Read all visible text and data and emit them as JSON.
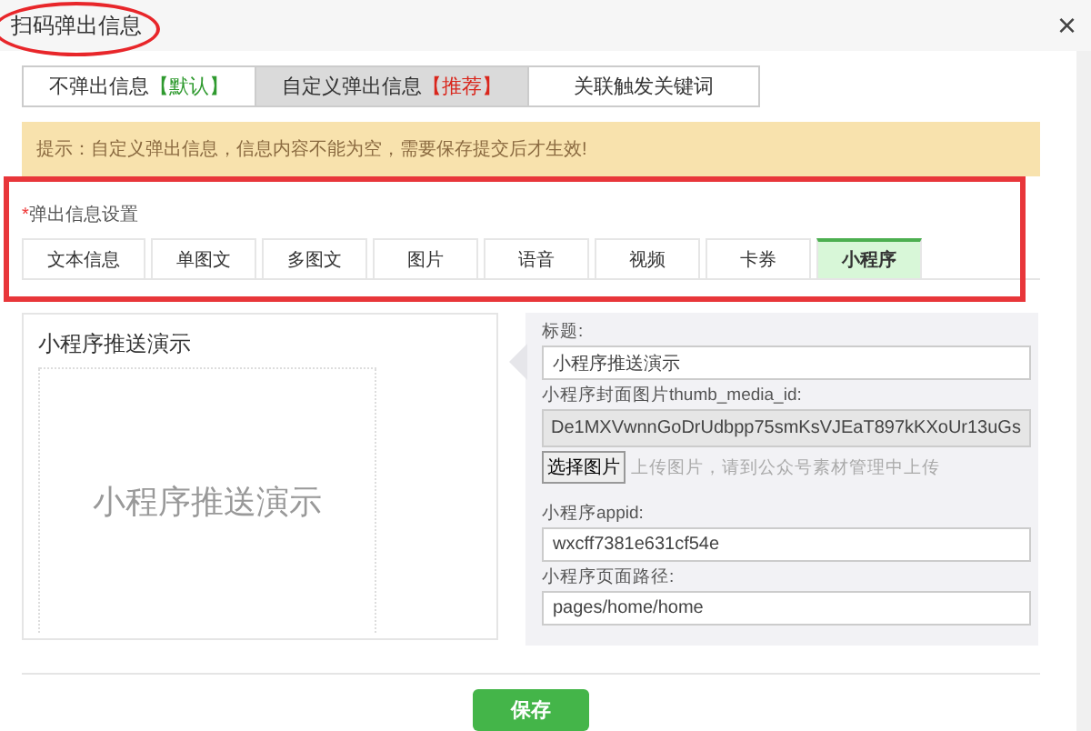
{
  "window": {
    "title": "扫码弹出信息",
    "close": "×",
    "title_circled": true
  },
  "mode_tabs": [
    {
      "label": "不弹出信息",
      "tag": "【默认】",
      "color": "#2f9a2f",
      "selected": false
    },
    {
      "label": "自定义弹出信息",
      "tag": "【推荐】",
      "color": "#d9261c",
      "selected": true
    },
    {
      "label": "关联触发关键词",
      "selected": false
    }
  ],
  "notice": "提示：自定义弹出信息，信息内容不能为空，需要保存提交后才生效!",
  "settings": {
    "framed": true,
    "required_mark": "*",
    "label": "弹出信息设置",
    "tabs": [
      {
        "label": "文本信息",
        "selected": false
      },
      {
        "label": "单图文",
        "selected": false
      },
      {
        "label": "多图文",
        "selected": false
      },
      {
        "label": "图片",
        "selected": false
      },
      {
        "label": "语音",
        "selected": false
      },
      {
        "label": "视频",
        "selected": false
      },
      {
        "label": "卡券",
        "selected": false
      },
      {
        "label": "小程序",
        "selected": true
      }
    ]
  },
  "preview": {
    "title": "小程序推送演示",
    "cover_text": "小程序推送演示"
  },
  "form": [
    {
      "kind": "input",
      "label": "标题:",
      "value": "小程序推送演示"
    },
    {
      "kind": "readonly",
      "label": "小程序封面图片thumb_media_id:",
      "value": "De1MXVwnnGoDrUdbpp75smKsVJEaT897kKXoUr13uGs"
    },
    {
      "kind": "upload",
      "button": "选择图片",
      "hint": "上传图片，请到公众号素材管理中上传"
    },
    {
      "kind": "input",
      "label": "小程序appid:",
      "value": "wxcff7381e631cf54e"
    },
    {
      "kind": "input",
      "label": "小程序页面路径:",
      "value": "pages/home/home"
    }
  ],
  "save_button": "保存"
}
